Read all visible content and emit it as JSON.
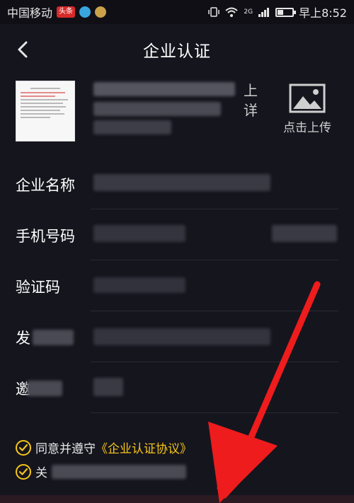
{
  "status_bar": {
    "carrier": "中国移动",
    "badge": "头条",
    "network": "2G",
    "time": "早上8:52"
  },
  "nav": {
    "title": "企业认证"
  },
  "upload": {
    "char_a": "上",
    "char_b": "详",
    "button_label": "点击上传"
  },
  "form": {
    "company_name_label": "企业名称",
    "phone_label": "手机号码",
    "code_label": "验证码",
    "row4_label_partial": "发",
    "row5_label_partial": "邀"
  },
  "agreement": {
    "agree_text": "同意并遵守",
    "agree_link": "《企业认证协议》",
    "second_partial": "关"
  },
  "colors": {
    "background": "#15151e",
    "accent": "#f5c518",
    "arrow": "#ee1c1c"
  }
}
